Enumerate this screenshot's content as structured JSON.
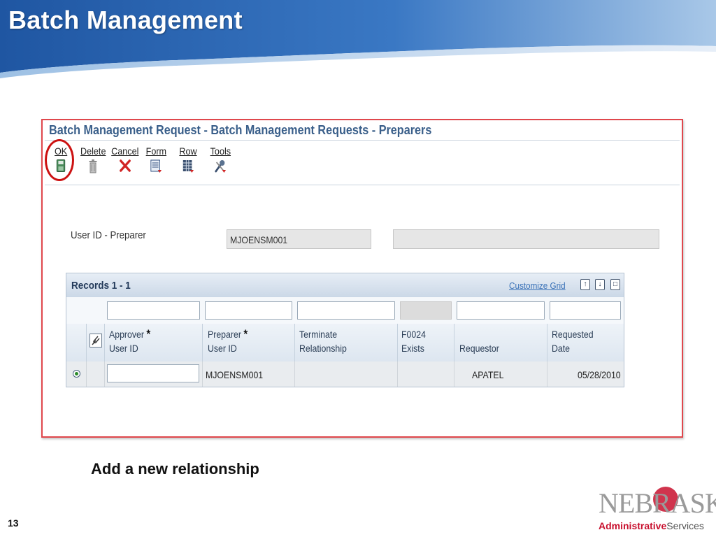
{
  "slide": {
    "title": "Batch Management",
    "caption": "Add a new relationship",
    "page_number": "13",
    "logo": {
      "word": "NEBRASKA",
      "sub_a": "Administrative",
      "sub_b": "Services"
    }
  },
  "app": {
    "title": "Batch Management Request - Batch Management Requests - Preparers",
    "toolbar": {
      "ok": "OK",
      "delete": "Delete",
      "cancel": "Cancel",
      "form": "Form",
      "row": "Row",
      "tools": "Tools"
    },
    "field": {
      "label": "User ID - Preparer",
      "value": "MJOENSM001",
      "description": ""
    },
    "grid": {
      "title": "Records 1 - 1",
      "customize_link": "Customize Grid",
      "columns": {
        "approver_1": "Approver",
        "approver_2": "User ID",
        "preparer_1": "Preparer",
        "preparer_2": "User ID",
        "terminate_1": "Terminate",
        "terminate_2": "Relationship",
        "f0024_1": "F0024",
        "f0024_2": "Exists",
        "requestor": "Requestor",
        "requested_1": "Requested",
        "requested_2": "Date",
        "required_mark": "*"
      },
      "rows": [
        {
          "approver": "",
          "preparer": "MJOENSM001",
          "terminate": "",
          "f0024": "",
          "requestor": "APATEL",
          "requested_date": "05/28/2010"
        }
      ]
    }
  },
  "colors": {
    "header_blue": "#2a63ad",
    "frame_red": "#e0474c",
    "highlight_circle": "#cc1111",
    "title_blue": "#3a5f8a"
  }
}
